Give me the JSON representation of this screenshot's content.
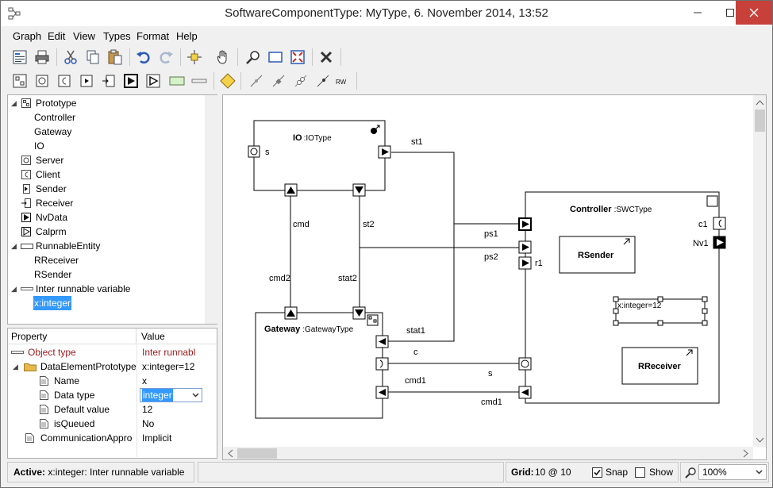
{
  "window": {
    "title": "SoftwareComponentType: MyType, 6. November 2014, 13:52"
  },
  "menu": [
    "Graph",
    "Edit",
    "View",
    "Types",
    "Format",
    "Help"
  ],
  "tree": {
    "items": [
      {
        "label": "Prototype"
      },
      {
        "label": "Controller"
      },
      {
        "label": "Gateway"
      },
      {
        "label": "IO"
      },
      {
        "label": "Server"
      },
      {
        "label": "Client"
      },
      {
        "label": "Sender"
      },
      {
        "label": "Receiver"
      },
      {
        "label": "NvData"
      },
      {
        "label": "Calprm"
      },
      {
        "label": "RunnableEntity"
      },
      {
        "label": "RReceiver"
      },
      {
        "label": "RSender"
      },
      {
        "label": "Inter runnable variable"
      },
      {
        "label": "x:integer"
      }
    ]
  },
  "props": {
    "col_property": "Property",
    "col_value": "Value",
    "rows": [
      {
        "prop": "Object type",
        "value": "Inter runnabl"
      },
      {
        "prop": "DataElementPrototype",
        "value": "x:integer=12"
      },
      {
        "prop": "Name",
        "value": "x"
      },
      {
        "prop": "Data type",
        "value": "integer"
      },
      {
        "prop": "Default value",
        "value": "12"
      },
      {
        "prop": "isQueued",
        "value": "No"
      },
      {
        "prop": "CommunicationAppro",
        "value": "Implicit"
      }
    ]
  },
  "diagram": {
    "io_name": "IO",
    "io_type": ":IOType",
    "gateway_name": "Gateway",
    "gateway_type": ":GatewayType",
    "controller_name": "Controller",
    "controller_type": ":SWCType",
    "rsender": "RSender",
    "rreceiver": "RReceiver",
    "irv": "x:integer=12",
    "labels": {
      "s_io": "s",
      "st1": "st1",
      "cmd": "cmd",
      "st2": "st2",
      "cmd2": "cmd2",
      "stat2": "stat2",
      "stat1": "stat1",
      "c": "c",
      "s_mid": "s",
      "cmd1_a": "cmd1",
      "cmd1_b": "cmd1",
      "ps1": "ps1",
      "ps2": "ps2",
      "r1": "r1",
      "c1": "c1",
      "nv1": "Nv1"
    }
  },
  "status": {
    "active_label": "Active:",
    "active_text": "x:integer: Inter runnable variable",
    "grid_label": "Grid:",
    "grid_value": "10 @ 10",
    "snap": "Snap",
    "show": "Show",
    "zoom": "100%"
  }
}
